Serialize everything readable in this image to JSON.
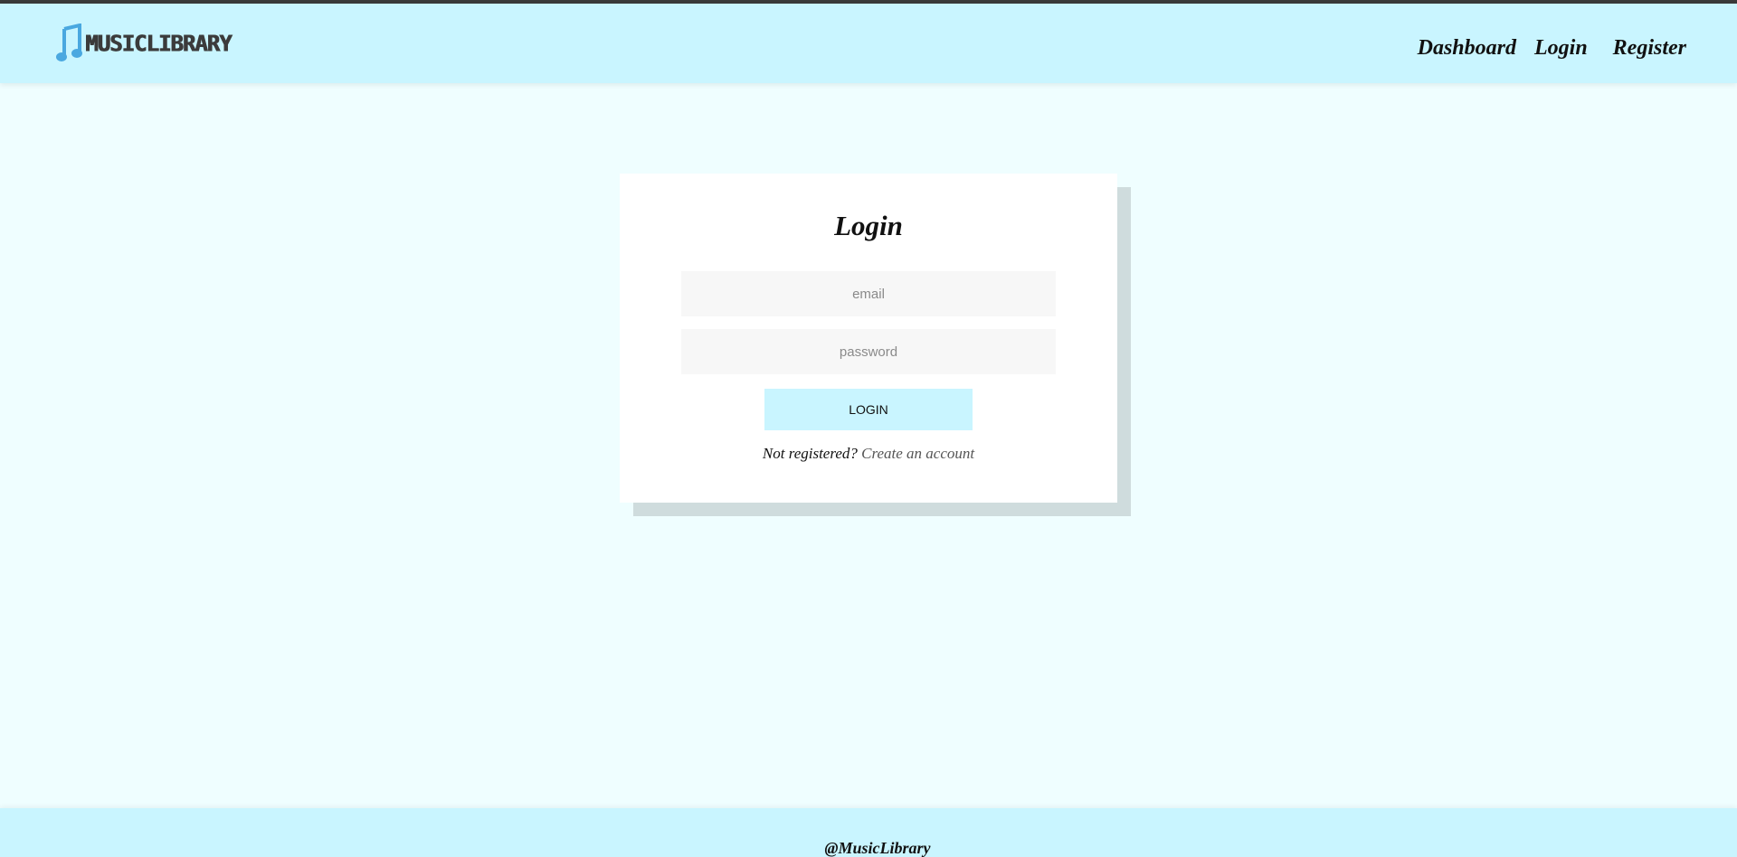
{
  "header": {
    "logo_text": "MUSICLIBRARY",
    "nav": {
      "dashboard": "Dashboard",
      "login": "Login",
      "register": "Register"
    }
  },
  "login_form": {
    "title": "Login",
    "email_placeholder": "email",
    "password_placeholder": "password",
    "submit_label": "LOGIN",
    "not_registered_text": "Not registered?",
    "create_account_link": "Create an account"
  },
  "footer": {
    "text": "@MusicLibrary"
  },
  "colors": {
    "page_background": "#effeff",
    "navbar_background": "#c9f5ff",
    "button_background": "#c9f5ff",
    "card_shadow": "#cfdcdd",
    "logo_icon": "#4aa8e0"
  },
  "icons": {
    "logo": "music-note-icon"
  }
}
